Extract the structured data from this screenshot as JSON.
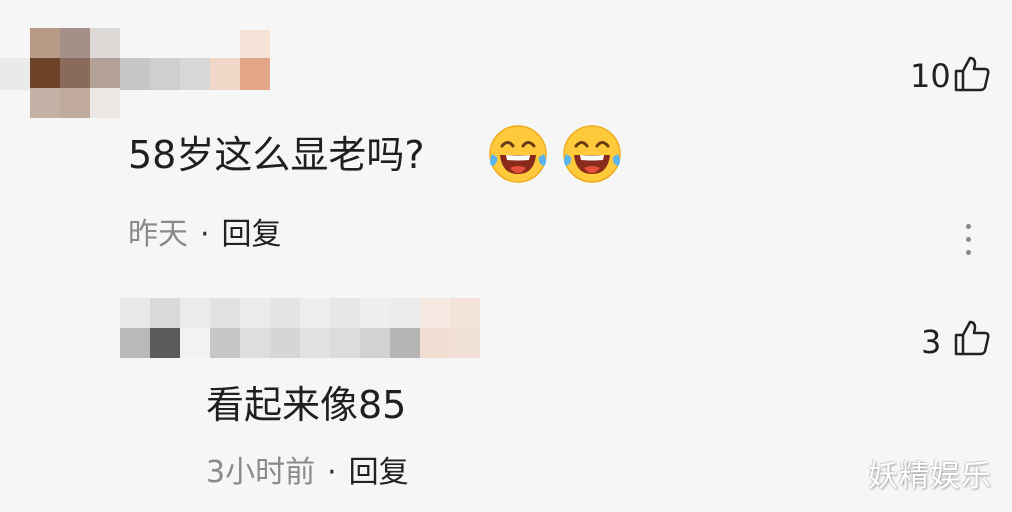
{
  "comments": [
    {
      "text": "58岁这么显老吗?",
      "emojis": [
        "laughing-crying-emoji",
        "laughing-crying-emoji"
      ],
      "time": "昨天",
      "separator": "·",
      "reply_label": "回复",
      "likes": "10",
      "like_icon": "thumbs-up-icon",
      "more_icon": "more-vertical-icon"
    },
    {
      "text": "看起来像85",
      "time": "3小时前",
      "separator": "·",
      "reply_label": "回复",
      "likes": "3",
      "like_icon": "thumbs-up-icon"
    }
  ],
  "watermark": "妖精娱乐",
  "colors": {
    "background": "#f6f6f6",
    "meta_gray": "#8a8a8a",
    "emoji_face": "#ffc93c"
  }
}
